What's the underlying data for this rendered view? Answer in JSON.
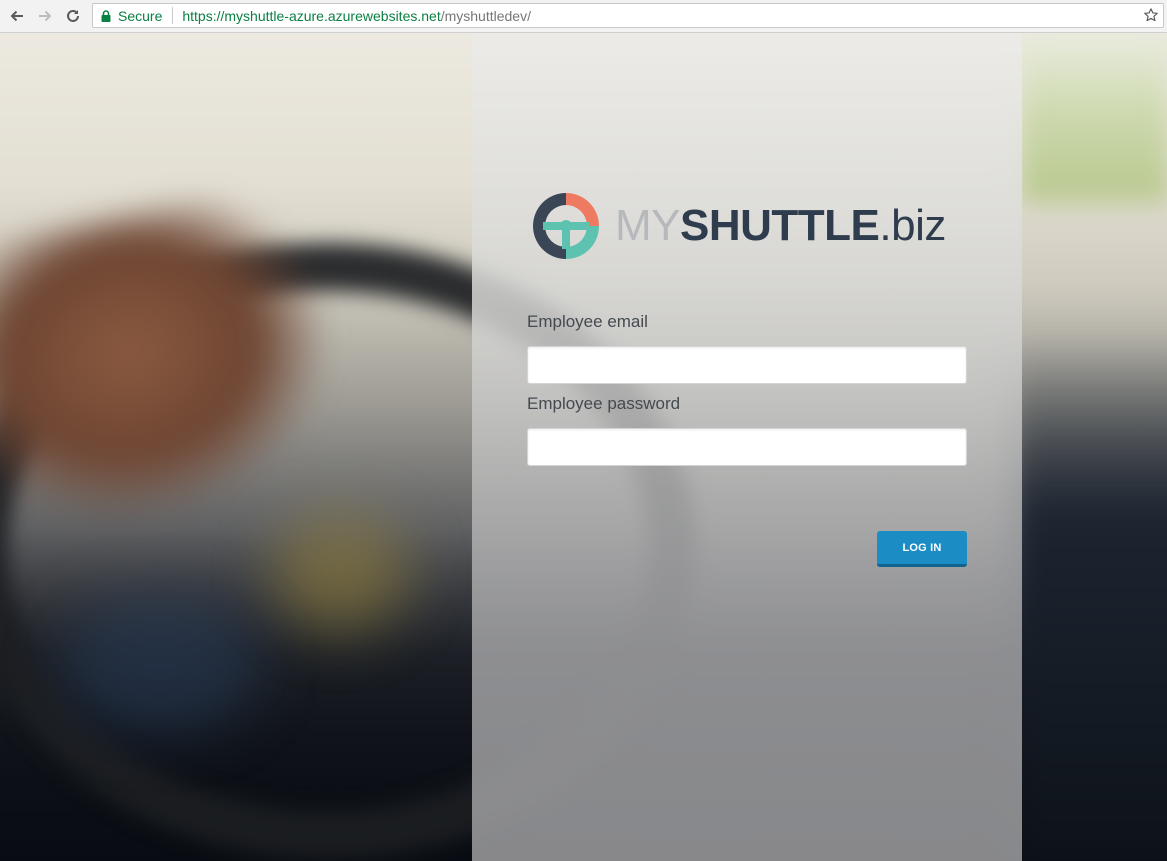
{
  "browser": {
    "back_icon": "arrow-left-icon",
    "forward_icon": "arrow-right-icon",
    "reload_icon": "reload-icon",
    "lock_icon": "lock-icon",
    "secure_label": "Secure",
    "url_host": "https://myshuttle-azure.azurewebsites.net",
    "url_path": "/myshuttledev/",
    "bookmark_icon": "star-icon",
    "secure_color": "#0b8043"
  },
  "logo": {
    "icon": "steering-wheel-logo-icon",
    "my": "MY",
    "shuttle": "SHUTTLE",
    "biz": ".biz",
    "colors": {
      "teal": "#5ec2b0",
      "coral": "#ef7a62",
      "navy": "#2e3c4d",
      "gray": "#b6b8bc"
    }
  },
  "form": {
    "email_label": "Employee email",
    "email_value": "",
    "password_label": "Employee password",
    "password_value": "",
    "login_label": "LOG IN",
    "button_color": "#1c8cc4"
  }
}
